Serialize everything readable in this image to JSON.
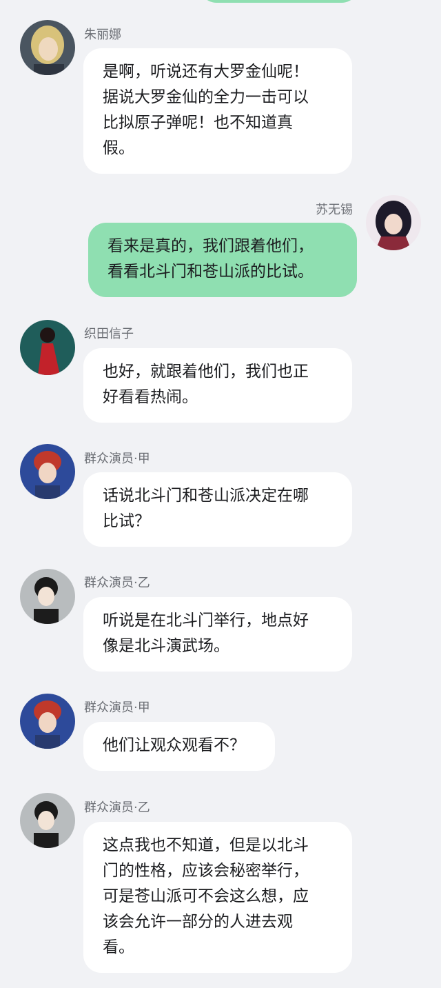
{
  "messages": [
    {
      "sender": "朱丽娜",
      "avatar": "blonde-woman-avatar-icon",
      "lines": [
        "是啊，听说还有大罗金仙呢！",
        "据说大罗金仙的全力一击可以",
        "比拟原子弹呢！也不知道真",
        "假。"
      ]
    },
    {
      "sender": "苏无锡",
      "avatar": "dark-haired-man-avatar-icon",
      "lines": [
        "看来是真的，我们跟着他们，",
        "看看北斗门和苍山派的比试。"
      ]
    },
    {
      "sender": "织田信子",
      "avatar": "red-dress-woman-avatar-icon",
      "lines": [
        "也好，就跟着他们，我们也正",
        "好看看热闹。"
      ]
    },
    {
      "sender": "群众演员·甲",
      "avatar": "red-haired-boy-avatar-icon",
      "lines": [
        "话说北斗门和苍山派决定在哪",
        "比试？"
      ]
    },
    {
      "sender": "群众演员·乙",
      "avatar": "black-haired-student-avatar-icon",
      "lines": [
        "听说是在北斗门举行，地点好",
        "像是北斗演武场。"
      ]
    },
    {
      "sender": "群众演员·甲",
      "avatar": "red-haired-boy-avatar-icon",
      "lines": [
        "他们让观众观看不？"
      ]
    },
    {
      "sender": "群众演员·乙",
      "avatar": "black-haired-student-avatar-icon",
      "lines": [
        "这点我也不知道，但是以北斗",
        "门的性格，应该会秘密举行，",
        "可是苍山派可不会这么想，应",
        "该会允许一部分的人进去观",
        "看。"
      ]
    }
  ],
  "colors": {
    "background": "#f1f2f5",
    "incoming_bubble": "#ffffff",
    "outgoing_bubble": "#8fdfb1",
    "name_text": "#6c6f75",
    "message_text": "#1c1d20"
  }
}
